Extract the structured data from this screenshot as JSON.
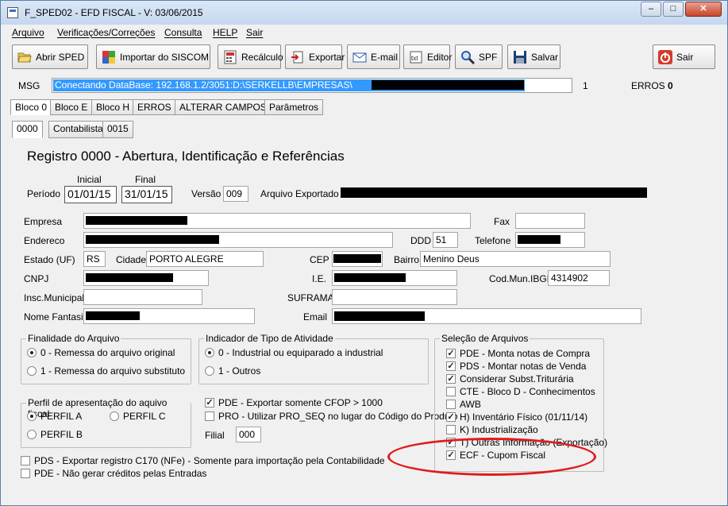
{
  "window": {
    "title": "F_SPED02 - EFD FISCAL - V: 03/06/2015",
    "btn_minimize": "–",
    "btn_maximize": "□",
    "btn_close": "✕"
  },
  "menu": [
    "Arquivo",
    "Verificações/Correções",
    "Consulta",
    "HELP",
    "Sair"
  ],
  "toolbar": {
    "abrir": "Abrir SPED",
    "importar": "Importar do SISCOM",
    "recalculo": "Recálculo",
    "exportar": "Exportar",
    "email": "E-mail",
    "editor": "Editor",
    "spf": "SPF",
    "salvar": "Salvar",
    "sair": "Sair"
  },
  "msgbar": {
    "label": "MSG",
    "value": "Conectando DataBase: 192.168.1.2/3051:D:\\SERKELLB\\EMPRESAS\\",
    "count": "1",
    "erros_label": "ERROS",
    "erros_value": "0"
  },
  "tabs": [
    "Bloco 0",
    "Bloco E",
    "Bloco H",
    "ERROS",
    "ALTERAR CAMPOS",
    "Parâmetros"
  ],
  "subtabs": [
    "0000",
    "Contabilista",
    "0015"
  ],
  "registro": {
    "heading": "Registro 0000 - Abertura, Identificação e Referências",
    "inicial_label": "Inicial",
    "final_label": "Final",
    "periodo_label": "Período",
    "inicial": "01/01/15",
    "final": "31/01/15",
    "versao_label": "Versão",
    "versao": "009",
    "arquivo_label": "Arquivo Exportado",
    "empresa_label": "Empresa",
    "fax_label": "Fax",
    "endereco_label": "Endereco",
    "ddd_label": "DDD",
    "ddd": "51",
    "telefone_label": "Telefone",
    "estado_label": "Estado (UF)",
    "estado": "RS",
    "cidade_label": "Cidade",
    "cidade": "PORTO ALEGRE",
    "cep_label": "CEP",
    "bairro_label": "Bairro",
    "bairro": "Menino Deus",
    "cnpj_label": "CNPJ",
    "ie_label": "I.E.",
    "codmun_label": "Cod.Mun.IBGE",
    "codmun": "4314902",
    "insc_label": "Insc.Municipal",
    "suframa_label": "SUFRAMA",
    "fantasia_label": "Nome Fantasia",
    "email_label": "Email"
  },
  "finalidade": {
    "title": "Finalidade do Arquivo",
    "opt0": "0 - Remessa do arquivo original",
    "opt1": "1 - Remessa do arquivo substituto"
  },
  "indicador": {
    "title": "Indicador de Tipo de Atividade",
    "opt0": "0 - Industrial ou equiparado a industrial",
    "opt1": "1 - Outros"
  },
  "perfil": {
    "title": "Perfil de apresentação do aquivo fiscal",
    "a": "PERFIL A",
    "b": "PERFIL B",
    "c": "PERFIL C"
  },
  "middle": {
    "pde": "PDE - Exportar somente CFOP > 1000",
    "pro": "PRO - Utilizar PRO_SEQ no lugar do Código do Produto",
    "filial_label": "Filial",
    "filial": "000"
  },
  "bottom": {
    "pds": "PDS - Exportar registro C170 (NFe) - Somente para importação pela Contabilidade",
    "pde": "PDE - Não gerar créditos pelas Entradas"
  },
  "selecao": {
    "title": "Seleção de Arquivos",
    "items": [
      {
        "label": "PDE - Monta notas de Compra",
        "checked": true
      },
      {
        "label": "PDS - Montar notas de Venda",
        "checked": true
      },
      {
        "label": "Considerar Subst.Triturária",
        "checked": true
      },
      {
        "label": "CTE - Bloco D - Conhecimentos",
        "checked": false
      },
      {
        "label": "AWB",
        "checked": false
      },
      {
        "label": "H) Inventário Físico (01/11/14)",
        "checked": true
      },
      {
        "label": "K) Industrialização",
        "checked": false
      },
      {
        "label": "T) Outras Informação (Exportação)",
        "checked": true
      },
      {
        "label": "ECF - Cupom Fiscal",
        "checked": true
      }
    ]
  },
  "colors": {
    "selection": "#3399ff",
    "annotation": "#e01b1b"
  }
}
